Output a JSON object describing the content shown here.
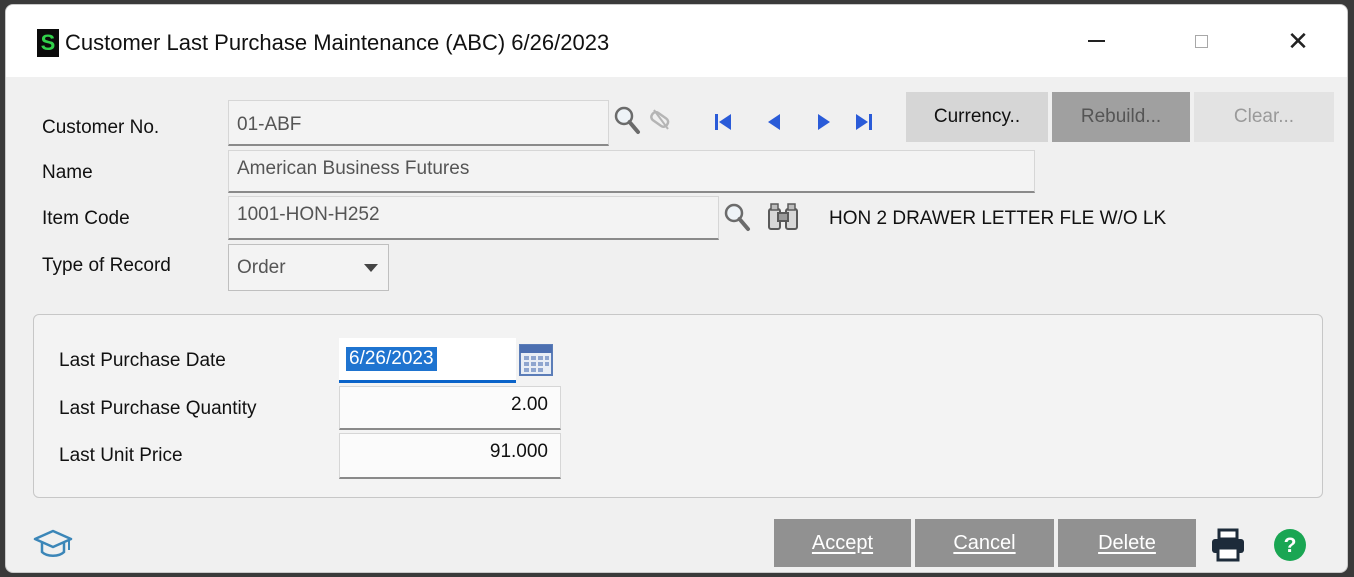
{
  "window": {
    "title": "Customer Last Purchase Maintenance (ABC) 6/26/2023",
    "logo_letter": "S",
    "minimize_glyph": "—",
    "close_glyph": "✕"
  },
  "header": {
    "customer_no_label": "Customer No.",
    "customer_no_value": "01-ABF",
    "name_label": "Name",
    "name_value": "American Business Futures",
    "item_code_label": "Item Code",
    "item_code_value": "1001-HON-H252",
    "item_description": "HON 2 DRAWER LETTER FLE W/O LK",
    "type_label": "Type of Record",
    "type_value": "Order"
  },
  "toolbar": {
    "currency_label": "Currency..",
    "rebuild_label": "Rebuild...",
    "clear_label": "Clear..."
  },
  "details": {
    "last_purchase_date_label": "Last Purchase Date",
    "last_purchase_date_value": "6/26/2023",
    "last_purchase_qty_label": "Last Purchase Quantity",
    "last_purchase_qty_value": "2.00",
    "last_unit_price_label": "Last Unit Price",
    "last_unit_price_value": "91.000"
  },
  "footer": {
    "accept_label": "Accept",
    "cancel_label": "Cancel",
    "delete_label": "Delete"
  },
  "icons": [
    "app-logo-icon",
    "lookup-icon",
    "record-link-icon",
    "first-record-icon",
    "previous-record-icon",
    "next-record-icon",
    "last-record-icon",
    "binoculars-icon",
    "calendar-icon",
    "graduation-cap-icon",
    "printer-icon",
    "help-icon",
    "dropdown-arrow-icon"
  ],
  "colors": {
    "accent": "#1f74d0",
    "logo_green": "#32d24b",
    "help_green": "#1aa653",
    "nav_blue": "#2a5bd8",
    "button_gray": "#919191"
  }
}
